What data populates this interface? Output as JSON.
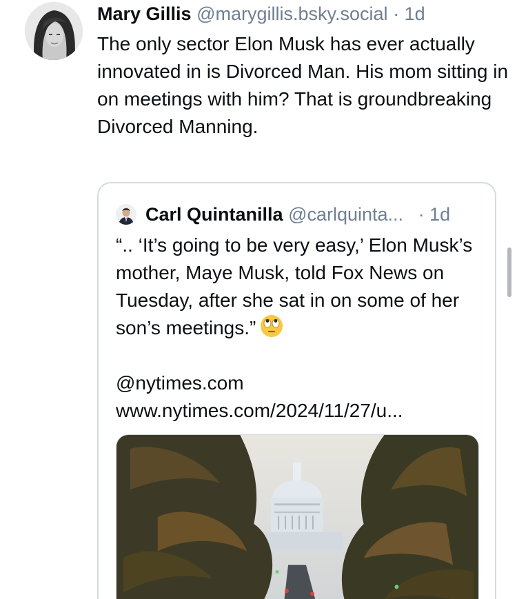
{
  "post": {
    "author_name": "Mary Gillis",
    "author_handle": "@marygillis.bsky.social",
    "separator": "·",
    "timestamp": "1d",
    "text": "The only sector Elon Musk has ever actually innovated in is Divorced Man. His mom sitting in on meetings with him? That is groundbreaking Divorced Manning."
  },
  "quote": {
    "author_name": "Carl Quintanilla",
    "author_handle": "@carlquinta...",
    "separator": "·",
    "timestamp": "1d",
    "text": "“.. ‘It’s going to be very easy,’ Elon Musk’s mother, Maye Musk, told Fox News on Tuesday, after she sat in on some of her son’s meetings.”",
    "emoji": "face-with-rolling-eyes",
    "mention": "@nytimes.com",
    "link": "www.nytimes.com/2024/11/27/u...",
    "media": "capitol-dome-photo"
  },
  "colors": {
    "text": "#0b0f14",
    "muted": "#6f7f92",
    "border": "#d4dbe2",
    "scrollbar": "#b4b8bd"
  }
}
